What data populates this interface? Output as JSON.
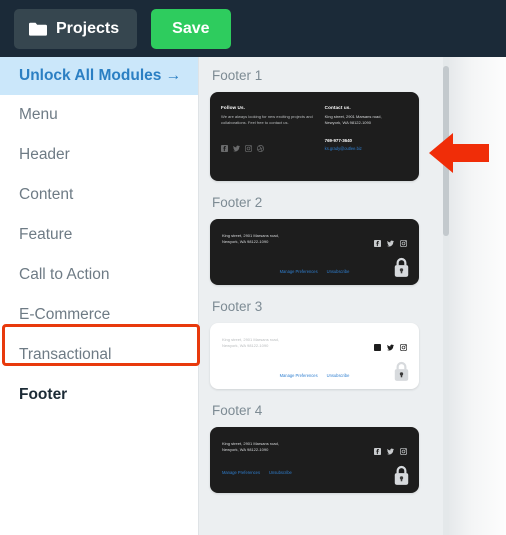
{
  "topbar": {
    "projects_label": "Projects",
    "projects_icon": "folder-icon",
    "save_label": "Save",
    "background": "#1b2a38",
    "save_color": "#2ecc5e"
  },
  "sidebar": {
    "items": [
      {
        "label": "Unlock All Modules →",
        "state": "promo",
        "accent": "#2b7fc3",
        "background": "#cbe7fa"
      },
      {
        "label": "Menu",
        "state": "default"
      },
      {
        "label": "Header",
        "state": "default"
      },
      {
        "label": "Content",
        "state": "default"
      },
      {
        "label": "Feature",
        "state": "default"
      },
      {
        "label": "Call to Action",
        "state": "default"
      },
      {
        "label": "E-Commerce",
        "state": "default"
      },
      {
        "label": "Transactional",
        "state": "default"
      },
      {
        "label": "Footer",
        "state": "selected"
      }
    ]
  },
  "annotations": {
    "highlight_color": "#e8390c",
    "box_target": "Footer",
    "arrow_icon": "left-arrow-annotation",
    "arrow_target": "Footer 1"
  },
  "content": {
    "blocks": [
      {
        "title": "Footer 1",
        "theme": "dark",
        "locked": false,
        "follow_heading": "Follow Us.",
        "follow_body": "We are always looking for new exciting projects and collaborations. Feel free to contact us.",
        "contact_heading": "Contact us.",
        "contact_address_line1": "King street, 2901 Marsans road,",
        "contact_address_line2": "Newyork, WA 98122-1090",
        "contact_phone": "769-977-3640",
        "contact_email": "ks.grady@outlee.biz",
        "socials": [
          "facebook-icon",
          "twitter-icon",
          "instagram-icon",
          "dribbble-icon"
        ]
      },
      {
        "title": "Footer 2",
        "theme": "dark",
        "locked": true,
        "address_line1": "King street, 2901 Marsans road,",
        "address_line2": "Newyork, WA 98122-1090",
        "links": [
          "Manage Preferences",
          "Unsubscribe"
        ],
        "links_align": "center",
        "socials": [
          "facebook-icon",
          "twitter-icon",
          "instagram-icon"
        ]
      },
      {
        "title": "Footer 3",
        "theme": "light",
        "locked": true,
        "address_line1": "King street, 2901 Marsans road,",
        "address_line2": "Newyork, WA 98122-1090",
        "links": [
          "Manage Preferences",
          "Unsubscribe"
        ],
        "links_align": "center",
        "socials": [
          "facebook-icon",
          "twitter-icon",
          "instagram-icon"
        ]
      },
      {
        "title": "Footer 4",
        "theme": "dark",
        "locked": true,
        "address_line1": "King street, 2901 Marsans road,",
        "address_line2": "Newyork, WA 98122-1090",
        "links": [
          "Manage Preferences",
          "Unsubscribe"
        ],
        "links_align": "left",
        "socials": [
          "facebook-icon",
          "twitter-icon",
          "instagram-icon"
        ]
      }
    ]
  },
  "scrollbar": {
    "orientation": "vertical",
    "thumb_position_percent": 2
  }
}
